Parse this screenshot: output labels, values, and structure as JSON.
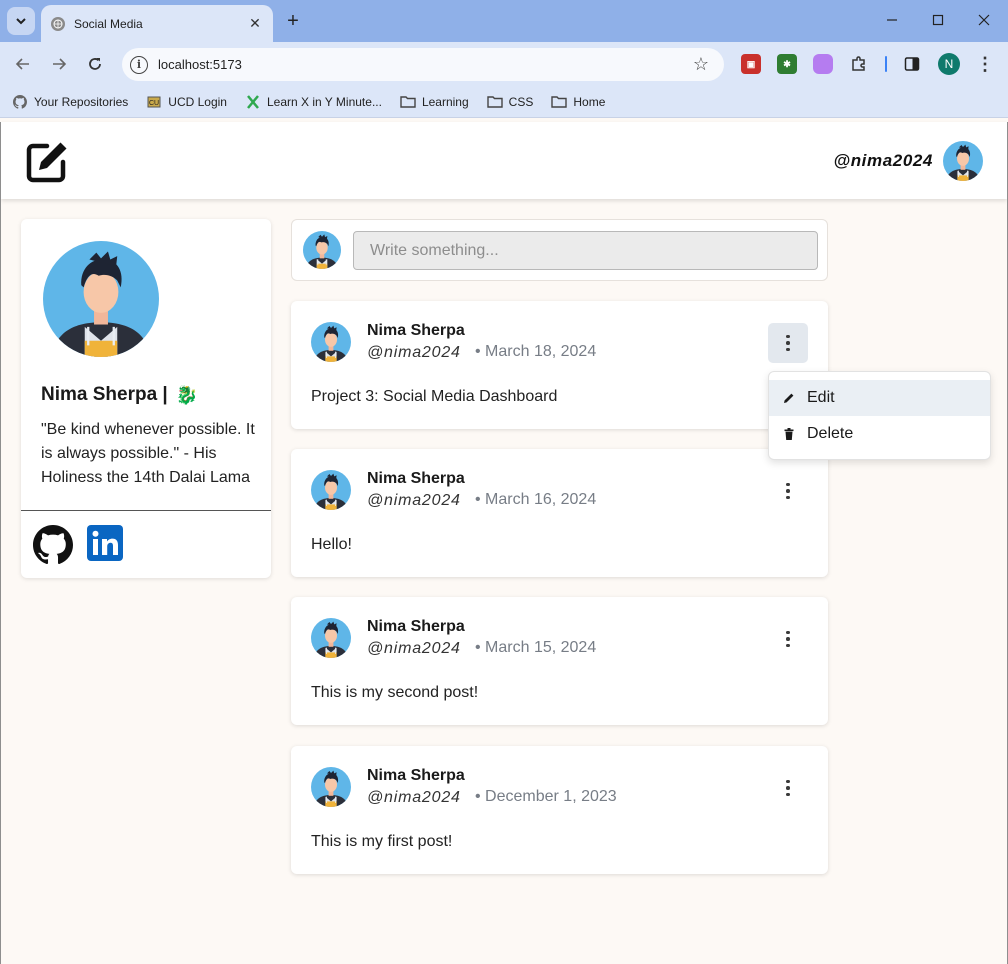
{
  "browser": {
    "tab_title": "Social Media",
    "url": "localhost:5173",
    "profile_initial": "N",
    "bookmarks": [
      {
        "label": "Your Repositories",
        "icon": "github-icon"
      },
      {
        "label": "UCD Login",
        "icon": "ucd-icon"
      },
      {
        "label": "Learn X in Y Minute...",
        "icon": "learnx-icon"
      },
      {
        "label": "Learning",
        "icon": "folder-icon"
      },
      {
        "label": "CSS",
        "icon": "folder-icon"
      },
      {
        "label": "Home",
        "icon": "folder-icon"
      }
    ]
  },
  "header": {
    "handle": "@nima2024"
  },
  "profile": {
    "name": "Nima Sherpa |",
    "emoji": "🐉",
    "bio": "\"Be kind whenever possible. It is always possible.\" - His Holiness the 14th Dalai Lama"
  },
  "composer": {
    "placeholder": "Write something..."
  },
  "posts": [
    {
      "author": "Nima Sherpa",
      "handle": "@nima2024",
      "date": "• March 18, 2024",
      "body": "Project 3: Social Media Dashboard"
    },
    {
      "author": "Nima Sherpa",
      "handle": "@nima2024",
      "date": "• March 16, 2024",
      "body": "Hello!"
    },
    {
      "author": "Nima Sherpa",
      "handle": "@nima2024",
      "date": "• March 15, 2024",
      "body": "This is my second post!"
    },
    {
      "author": "Nima Sherpa",
      "handle": "@nima2024",
      "date": "• December 1, 2023",
      "body": "This is my first post!"
    }
  ],
  "post_menu": {
    "edit_label": "Edit",
    "delete_label": "Delete"
  },
  "colors": {
    "page_bg": "#fdf9f5",
    "chrome_frame": "#8fb0e8",
    "chrome_toolbar": "#dce6f8",
    "linkedin": "#0a66c2",
    "avatar_bg": "#5fb6e8"
  }
}
